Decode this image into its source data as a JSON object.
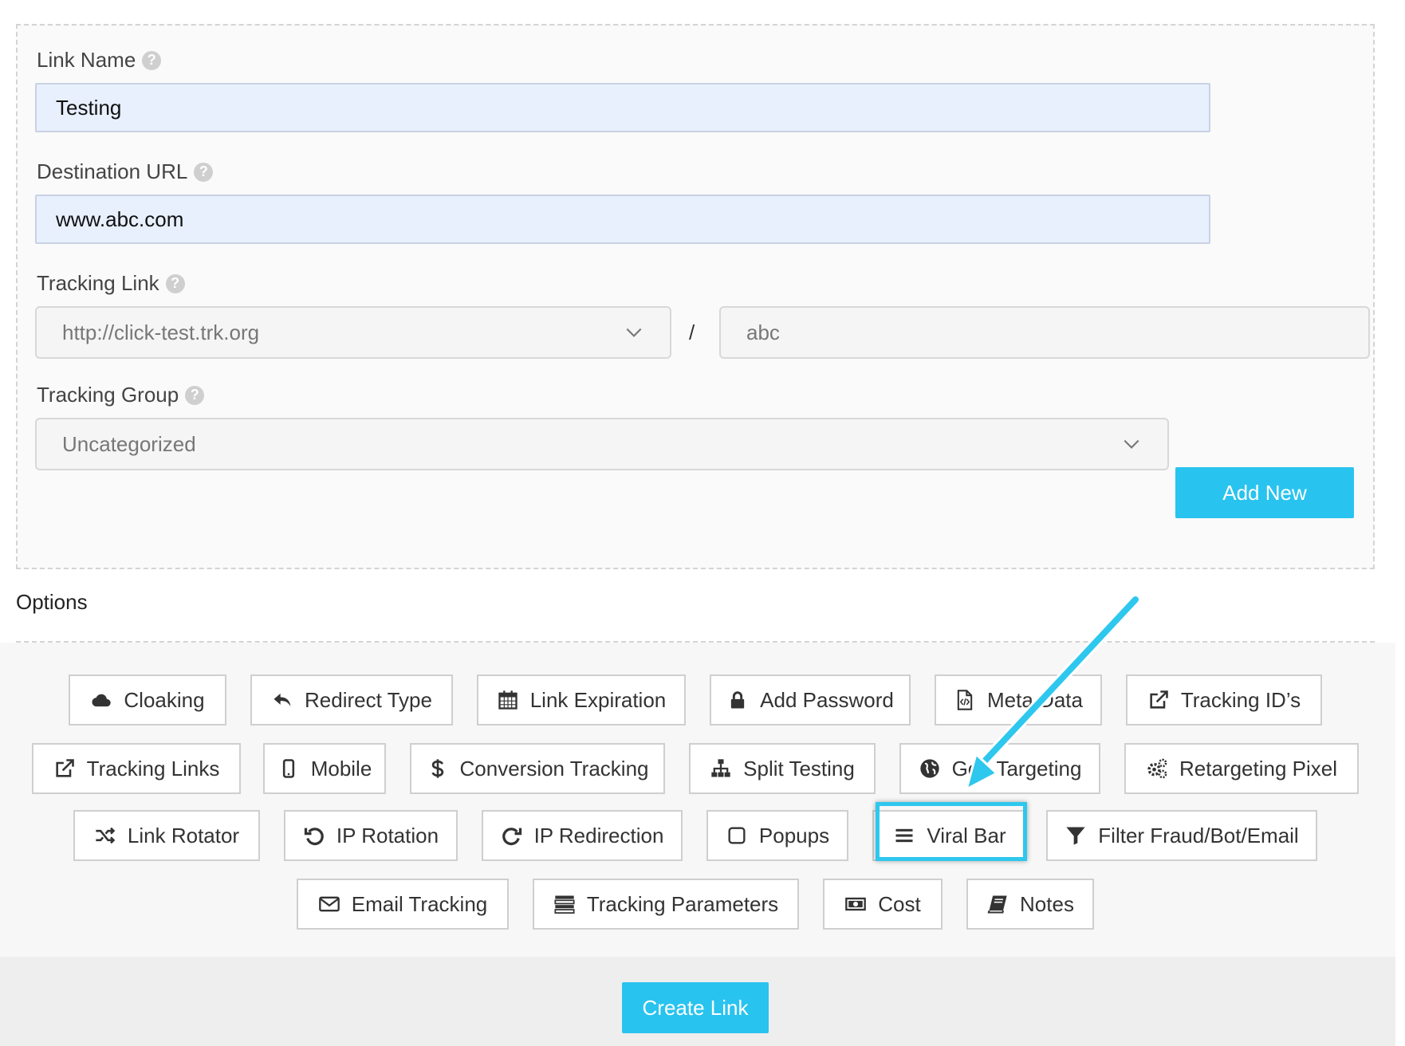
{
  "form": {
    "link_name": {
      "label": "Link Name",
      "value": "Testing"
    },
    "destination_url": {
      "label": "Destination URL",
      "value": "www.abc.com"
    },
    "tracking_link": {
      "label": "Tracking Link",
      "domain": "http://click-test.trk.org",
      "separator": "/",
      "slug": "abc"
    },
    "tracking_group": {
      "label": "Tracking Group",
      "value": "Uncategorized",
      "add_button": "Add New"
    },
    "help_glyph": "?"
  },
  "options": {
    "title": "Options",
    "buttons": [
      {
        "label": "Cloaking",
        "icon": "cloud-icon"
      },
      {
        "label": "Redirect Type",
        "icon": "reply-icon"
      },
      {
        "label": "Link Expiration",
        "icon": "calendar-icon"
      },
      {
        "label": "Add Password",
        "icon": "lock-icon"
      },
      {
        "label": "Meta Data",
        "icon": "code-file-icon"
      },
      {
        "label": "Tracking ID’s",
        "icon": "external-link-icon"
      },
      {
        "label": "Tracking Links",
        "icon": "external-link-icon"
      },
      {
        "label": "Mobile",
        "icon": "mobile-icon"
      },
      {
        "label": "Conversion Tracking",
        "icon": "dollar-icon"
      },
      {
        "label": "Split Testing",
        "icon": "sitemap-icon"
      },
      {
        "label": "Geo Targeting",
        "icon": "globe-icon"
      },
      {
        "label": "Retargeting Pixel",
        "icon": "cogs-icon"
      },
      {
        "label": "Link Rotator",
        "icon": "shuffle-icon"
      },
      {
        "label": "IP Rotation",
        "icon": "undo-icon"
      },
      {
        "label": "IP Redirection",
        "icon": "redo-icon"
      },
      {
        "label": "Popups",
        "icon": "square-icon"
      },
      {
        "label": "Viral Bar",
        "icon": "bars-icon"
      },
      {
        "label": "Filter Fraud/Bot/Email",
        "icon": "filter-icon"
      },
      {
        "label": "Email Tracking",
        "icon": "envelope-icon"
      },
      {
        "label": "Tracking Parameters",
        "icon": "list-icon"
      },
      {
        "label": "Cost",
        "icon": "money-icon"
      },
      {
        "label": "Notes",
        "icon": "book-icon"
      }
    ]
  },
  "footer": {
    "create_label": "Create Link"
  },
  "colors": {
    "accent": "#29c3ef",
    "input_bg": "#e8f0fe",
    "highlight": "#2ec7ee"
  }
}
